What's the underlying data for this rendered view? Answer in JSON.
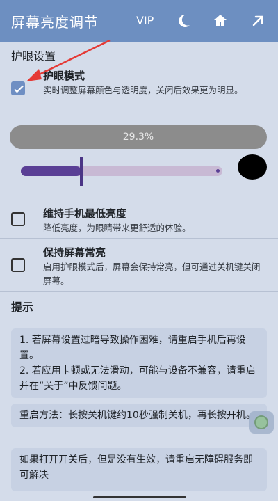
{
  "header": {
    "title": "屏幕亮度调节",
    "vip": "VIP",
    "icons": [
      "moon-icon",
      "home-icon",
      "arrow-out-icon"
    ]
  },
  "eye_section": {
    "title": "护眼设置",
    "eye_mode": {
      "label": "护眼模式",
      "desc": "实时调整屏幕颜色与透明度，关闭后效果更为明显。",
      "checked": true
    }
  },
  "progress": {
    "label": "29.3%",
    "value": 0.293
  },
  "slider": {
    "value": 0.3
  },
  "options": [
    {
      "label": "维持手机最低亮度",
      "desc": "降低亮度，为眼睛带来更舒适的体验。",
      "checked": false
    },
    {
      "label": "保持屏幕常亮",
      "desc": "启用护眼模式后，屏幕会保持常亮，但可通过关机键关闭屏幕。",
      "checked": false
    }
  ],
  "tips": {
    "title": "提示",
    "cards": [
      "1. 若屏幕设置过暗导致操作困难，请重启手机后再设置。\n2. 若应用卡顿或无法滑动，可能与设备不兼容，请重启并在“关于”中反馈问题。",
      "重启方法：长按关机键约10秒强制关机，再长按开机。",
      "如果打开开关后，但是没有生效，请重启无障碍服务即可解决"
    ]
  },
  "colors": {
    "header_bg": "#6d8fc1",
    "page_bg": "#d4dcea",
    "card_bg": "#c7d1e3",
    "accent": "#6f8fc3",
    "slider_fill": "#5a3f95",
    "arrow": "#e53935"
  }
}
